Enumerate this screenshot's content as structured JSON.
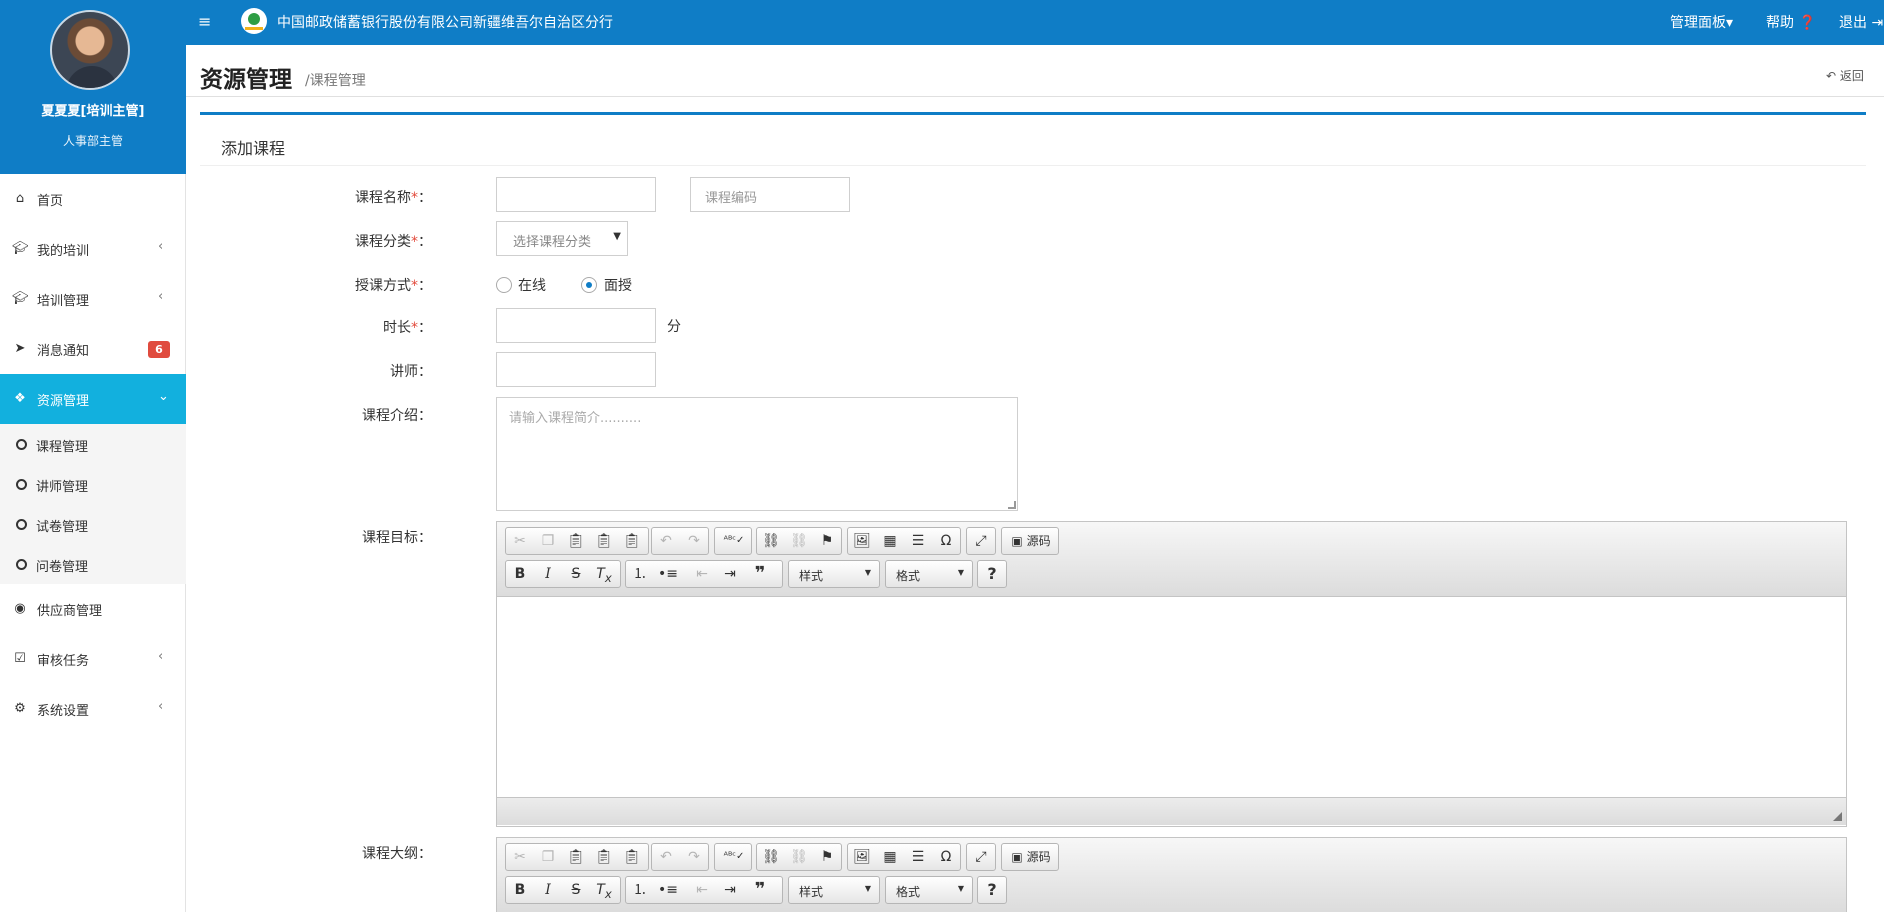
{
  "header": {
    "org_name": "中国邮政储蓄银行股份有限公司新疆维吾尔自治区分行",
    "nav": {
      "dashboard": "管理面板▾",
      "help": "帮助 ❓",
      "logout": "退出 ⇥"
    }
  },
  "user": {
    "name": "夏夏夏[培训主管]",
    "role": "人事部主管"
  },
  "sidebar": {
    "items": [
      {
        "label": "首页"
      },
      {
        "label": "我的培训"
      },
      {
        "label": "培训管理"
      },
      {
        "label": "消息通知",
        "badge": "6"
      },
      {
        "label": "资源管理"
      },
      {
        "label": "供应商管理"
      },
      {
        "label": "审核任务"
      },
      {
        "label": "系统设置"
      }
    ],
    "submenu": [
      {
        "label": "课程管理"
      },
      {
        "label": "讲师管理"
      },
      {
        "label": "试卷管理"
      },
      {
        "label": "问卷管理"
      }
    ]
  },
  "page": {
    "title": "资源管理",
    "breadcrumb": "/课程管理",
    "back": "返回"
  },
  "form": {
    "panel_title": "添加课程",
    "labels": {
      "course_name": "课程名称",
      "category": "课程分类",
      "mode": "授课方式",
      "duration": "时长",
      "teacher": "讲师",
      "intro": "课程介绍",
      "goal": "课程目标",
      "outline": "课程大纲"
    },
    "required_mark": "*",
    "colon": "：",
    "course_code_placeholder": "课程编码",
    "category_placeholder": "选择课程分类",
    "mode_options": [
      "在线",
      "面授"
    ],
    "mode_selected": "面授",
    "duration_unit": "分",
    "intro_placeholder": "请输入课程简介..........",
    "editor": {
      "source_label": "源码",
      "style_label": "样式",
      "format_label": "格式",
      "help_label": "?"
    }
  },
  "colors": {
    "primary": "#0f7dc6",
    "active_menu": "#12b0de",
    "badge": "#e04b3e",
    "required": "#e24a3b"
  }
}
